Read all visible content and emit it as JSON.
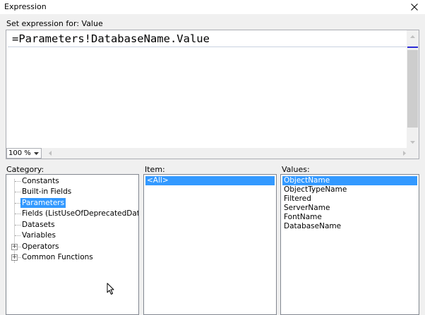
{
  "window": {
    "title": "Expression"
  },
  "expression": {
    "label": "Set expression for: Value",
    "text": "=Parameters!DatabaseName.Value",
    "zoom": "100 %"
  },
  "category": {
    "label": "Category:",
    "items": [
      {
        "label": "Constants",
        "selected": false,
        "expandable": false
      },
      {
        "label": "Built-in Fields",
        "selected": false,
        "expandable": false
      },
      {
        "label": "Parameters",
        "selected": true,
        "expandable": false
      },
      {
        "label": "Fields (ListUseOfDeprecatedDataTyp",
        "selected": false,
        "expandable": false
      },
      {
        "label": "Datasets",
        "selected": false,
        "expandable": false
      },
      {
        "label": "Variables",
        "selected": false,
        "expandable": false
      },
      {
        "label": "Operators",
        "selected": false,
        "expandable": true
      },
      {
        "label": "Common Functions",
        "selected": false,
        "expandable": true
      }
    ]
  },
  "item": {
    "label": "Item:",
    "items": [
      {
        "label": "<All>",
        "selected": true
      }
    ]
  },
  "values": {
    "label": "Values:",
    "items": [
      {
        "label": "ObjectName",
        "selected": true
      },
      {
        "label": "ObjectTypeName",
        "selected": false
      },
      {
        "label": "Filtered",
        "selected": false
      },
      {
        "label": "ServerName",
        "selected": false
      },
      {
        "label": "FontName",
        "selected": false
      },
      {
        "label": "DatabaseName",
        "selected": false
      }
    ]
  },
  "icons": {
    "close": "close-icon",
    "expand": "plus-icon",
    "scroll_up": "chevron-up-icon",
    "scroll_down": "chevron-down-icon",
    "scroll_left": "chevron-left-icon",
    "scroll_right": "chevron-right-icon",
    "cursor": "mouse-pointer-icon"
  },
  "colors": {
    "selection": "#3399ff",
    "dialog_bg": "#f0f0f0"
  }
}
